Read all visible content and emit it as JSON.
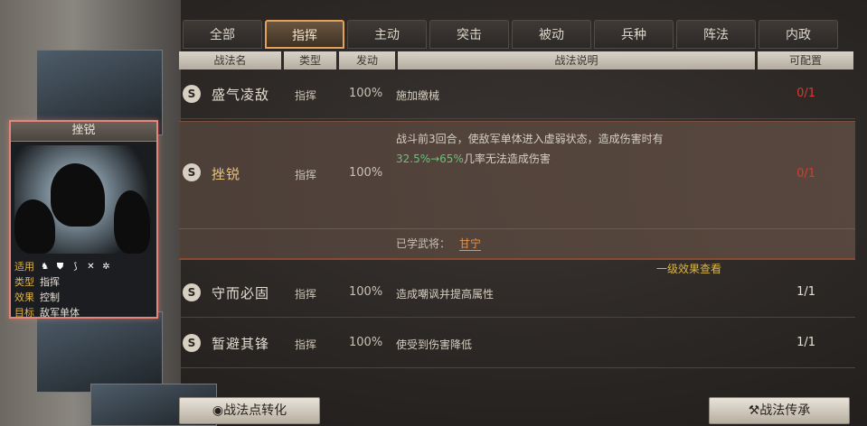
{
  "tabs": [
    "全部",
    "指挥",
    "主动",
    "突击",
    "被动",
    "兵种",
    "阵法",
    "内政"
  ],
  "active_tab": 1,
  "columns": {
    "name": "战法名",
    "type": "类型",
    "rate": "发动",
    "desc": "战法说明",
    "config": "可配置"
  },
  "skills": [
    {
      "badge": "S",
      "name": "盛气凌敌",
      "type": "指挥",
      "rate": "100%",
      "desc": "施加缴械",
      "config": "0/1",
      "config_color": "#d53b2e"
    },
    {
      "badge": "S",
      "name": "挫锐",
      "type": "指挥",
      "rate": "100%",
      "desc_line1": "战斗前3回合，使敌军单体进入虚弱状态，造成伤害时有",
      "desc_highlight": "32.5%→65%",
      "desc_line2": "几率无法造成伤害",
      "config": "0/1",
      "config_color": "#d53b2e",
      "effect_link": "一级效果查看",
      "learned_label": "已学武将：",
      "learned_general": "甘宁"
    },
    {
      "badge": "S",
      "name": "守而必固",
      "type": "指挥",
      "rate": "100%",
      "desc": "造成嘲讽并提高属性",
      "config": "1/1",
      "config_color": "#e6e1d6"
    },
    {
      "badge": "S",
      "name": "暂避其锋",
      "type": "指挥",
      "rate": "100%",
      "desc": "使受到伤害降低",
      "config": "1/1",
      "config_color": "#e6e1d6"
    }
  ],
  "card": {
    "title": "挫锐",
    "suit_label": "适用",
    "type_label": "类型",
    "type_value": "指挥",
    "effect_label": "效果",
    "effect_value": "控制",
    "target_label": "目标",
    "target_value": "敌军单体",
    "unit_icons": [
      "cavalry-icon",
      "shield-icon",
      "bow-icon",
      "spear-icon",
      "siege-icon"
    ]
  },
  "buttons": {
    "convert": "战法点转化",
    "inherit": "战法传承"
  }
}
